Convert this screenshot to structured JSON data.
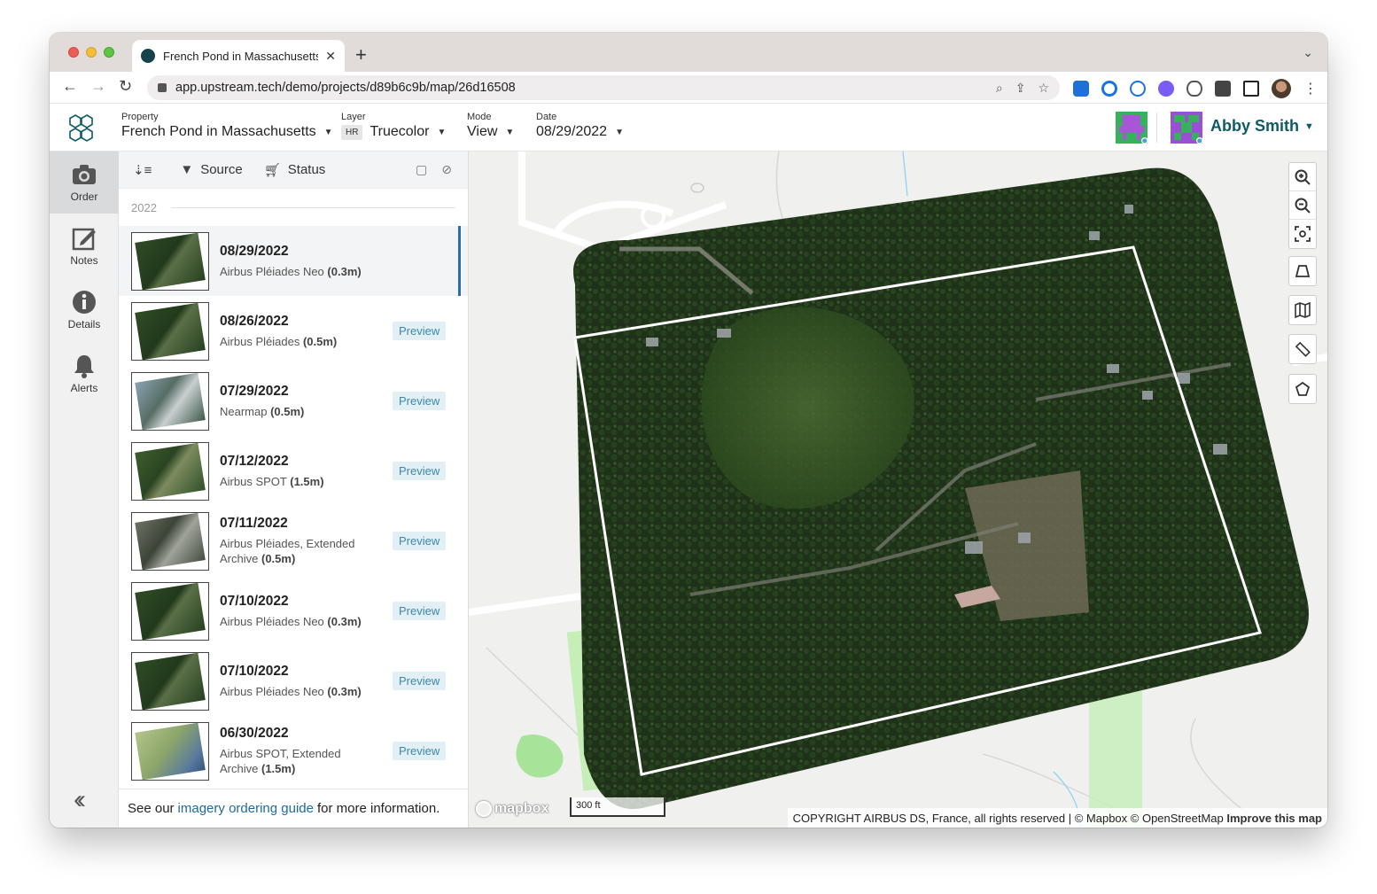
{
  "browser": {
    "tab_title": "French Pond in Massachusetts",
    "url": "app.upstream.tech/demo/projects/d89b6c9b/map/26d16508"
  },
  "header": {
    "property": {
      "label": "Property",
      "value": "French Pond in Massachusetts"
    },
    "layer": {
      "label": "Layer",
      "badge": "HR",
      "value": "Truecolor"
    },
    "mode": {
      "label": "Mode",
      "value": "View"
    },
    "date": {
      "label": "Date",
      "value": "08/29/2022"
    },
    "user": {
      "name": "Abby Smith"
    },
    "accent_color": "#0e5b63"
  },
  "rail": {
    "items": [
      {
        "label": "Order",
        "icon": "camera-icon",
        "active": true
      },
      {
        "label": "Notes",
        "icon": "edit-icon",
        "active": false
      },
      {
        "label": "Details",
        "icon": "info-icon",
        "active": false
      },
      {
        "label": "Alerts",
        "icon": "bell-icon",
        "active": false
      }
    ]
  },
  "panel": {
    "filters": {
      "source": "Source",
      "status": "Status"
    },
    "year": "2022",
    "preview_label": "Preview",
    "items": [
      {
        "date": "08/29/2022",
        "source": "Airbus Pléiades Neo",
        "resolution": "(0.3m)",
        "active": true,
        "style": "green"
      },
      {
        "date": "08/26/2022",
        "source": "Airbus Pléiades",
        "resolution": "(0.5m)",
        "active": false,
        "style": "green"
      },
      {
        "date": "07/29/2022",
        "source": "Nearmap",
        "resolution": "(0.5m)",
        "active": false,
        "style": "nearmap"
      },
      {
        "date": "07/12/2022",
        "source": "Airbus SPOT",
        "resolution": "(1.5m)",
        "active": false,
        "style": "spot"
      },
      {
        "date": "07/11/2022",
        "source": "Airbus Pléiades, Extended Archive",
        "resolution": "(0.5m)",
        "active": false,
        "style": "gray"
      },
      {
        "date": "07/10/2022",
        "source": "Airbus Pléiades Neo",
        "resolution": "(0.3m)",
        "active": false,
        "style": "green"
      },
      {
        "date": "07/10/2022",
        "source": "Airbus Pléiades Neo",
        "resolution": "(0.3m)",
        "active": false,
        "style": "green"
      },
      {
        "date": "06/30/2022",
        "source": "Airbus SPOT, Extended Archive",
        "resolution": "(1.5m)",
        "active": false,
        "style": "coast"
      }
    ],
    "footer": {
      "before": "See our",
      "link": "imagery ordering guide",
      "after": "for more information."
    }
  },
  "map": {
    "scale_label": "300 ft",
    "logo": "mapbox",
    "attribution": "COPYRIGHT AIRBUS DS, France, all rights reserved | © Mapbox © OpenStreetMap",
    "improve": "Improve this map"
  }
}
